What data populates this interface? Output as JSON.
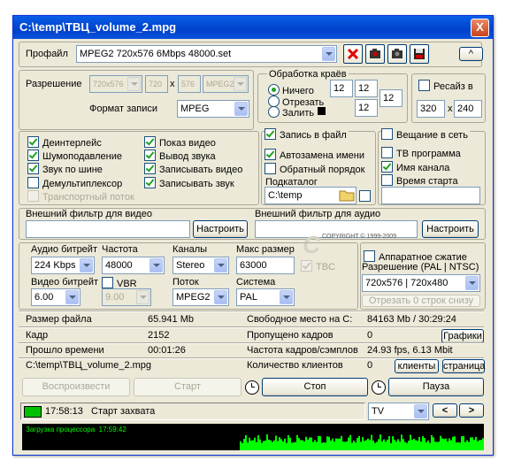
{
  "window": {
    "title": "C:\\temp\\ТВЦ_volume_2.mpg",
    "close": "X"
  },
  "profile": {
    "label": "Профайл",
    "value": "MPEG2 720x576 6Mbps 48000.set",
    "collapse_btn": "^"
  },
  "resolution": {
    "label": "Разрешение",
    "preset": "720x576",
    "width": "720",
    "x_sep": "x",
    "height": "576",
    "codec": "MPEG2"
  },
  "format": {
    "label": "Формат записи",
    "value": "MPEG"
  },
  "edges": {
    "title": "Обработка краёв",
    "opt_none": "Ничего",
    "opt_cut": "Отрезать",
    "opt_fill": "Залить",
    "v1": "12",
    "v2": "12",
    "v3": "12",
    "v4": "12"
  },
  "resize": {
    "label": "Ресайз в",
    "w": "320",
    "x_sep": "x",
    "h": "240"
  },
  "options_left": [
    {
      "label": "Деинтерлейс",
      "checked": true,
      "disabled": false
    },
    {
      "label": "Шумоподавление",
      "checked": true,
      "disabled": false
    },
    {
      "label": "Звук по шине",
      "checked": true,
      "disabled": false
    },
    {
      "label": "Демультиплексор",
      "checked": false,
      "disabled": false
    },
    {
      "label": "Транспортный поток",
      "checked": false,
      "disabled": true
    }
  ],
  "options_mid": [
    {
      "label": "Показ видео",
      "checked": true
    },
    {
      "label": "Вывод звука",
      "checked": true
    },
    {
      "label": "Записывать видео",
      "checked": true
    },
    {
      "label": "Записывать звук",
      "checked": true
    }
  ],
  "file_opts": {
    "write_file": "Запись в файл",
    "autorename": "Автозамена имени",
    "reverse": "Обратный порядок",
    "subdir_label": "Подкаталог",
    "subdir": "C:\\temp"
  },
  "broadcast": {
    "label": "Вещание в сеть",
    "tv_program": "ТВ программа",
    "channel_name": "Имя канала",
    "start_time": "Время старта"
  },
  "filters": {
    "video_label": "Внешний фильтр для видео",
    "audio_label": "Внешний фильтр для аудио",
    "configure": "Настроить",
    "copyright": "COPYRIGHT © 1999-2009"
  },
  "audio": {
    "bitrate_label": "Аудио битрейт",
    "bitrate": "224 Kbps",
    "freq_label": "Частота",
    "freq": "48000",
    "channels_label": "Каналы",
    "channels": "Stereo",
    "max_size_label": "Макс размер",
    "max_size": "63000",
    "tbc": "TBC"
  },
  "video": {
    "bitrate_label": "Видео битрейт",
    "bitrate": "6.00",
    "vbr": "VBR",
    "vbr_value": "9.00",
    "stream_label": "Поток",
    "stream": "MPEG2",
    "system_label": "Система",
    "system": "PAL"
  },
  "hw": {
    "label": "Аппаратное сжатие",
    "res_label": "Разрешение (PAL | NTSC)",
    "res": "720x576 | 720x480",
    "cut_btn": "Отрезать 0 строк снизу"
  },
  "stats": {
    "file_size_label": "Размер файла",
    "file_size": "65.941 Mb",
    "free_label": "Свободное место на C:",
    "free": "84163 Mb / 30:29:24",
    "frame_label": "Кадр",
    "frame": "2152",
    "dropped_label": "Пропущено кадров",
    "dropped": "0",
    "graphs_btn": "Графики",
    "elapsed_label": "Прошло времени",
    "elapsed": "00:01:26",
    "rate_label": "Частота кадров/сэмплов",
    "rate": "24.93 fps, 6.13 Mbit",
    "path": "C:\\temp\\ТВЦ_volume_2.mpg",
    "clients_label": "Количество клиентов",
    "clients": "0",
    "clients_btn": "клиенты",
    "page_btn": "страница"
  },
  "controls": {
    "play": "Воспроизвести",
    "start": "Старт",
    "stop": "Стоп",
    "pause": "Пауза"
  },
  "status": {
    "time": "17:58:13",
    "text": "Старт захвата",
    "source": "TV",
    "prev": "<",
    "next": ">"
  },
  "cpu": {
    "label": "Загрузка процессора",
    "time": "17:59:42",
    "color": "#00ff00"
  },
  "colors": {
    "titlebar": "#0041c9",
    "face": "#ece9d8",
    "check": "#21a121",
    "delete_red": "#e00000"
  }
}
